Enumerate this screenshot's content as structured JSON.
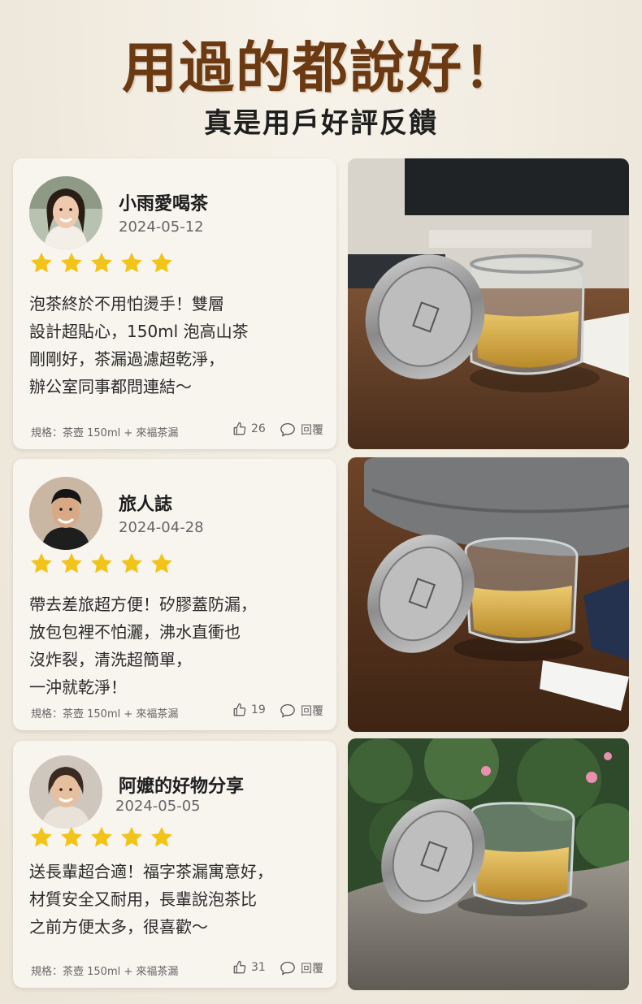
{
  "header": {
    "title": "用過的都說好！",
    "subtitle": "真是用戶好評反饋"
  },
  "colors": {
    "title": "#6b3a12",
    "star": "#f2c318",
    "card_bg": "#f8f5ef",
    "page_bg": "#f1ece2"
  },
  "reviews": [
    {
      "name": "小雨愛喝茶",
      "date": "2024-05-12",
      "rating": 5,
      "lines": [
        "泡茶終於不用怕燙手！雙層",
        "設計超貼心，150ml 泡高山茶",
        "剛剛好，茶漏過濾超乾淨，",
        "辦公室同事都問連結～"
      ],
      "spec": "規格：茶壺 150ml + 來福茶漏",
      "likes": "26",
      "reply": "回覆",
      "photo": "office-desk-tea-cup-photo"
    },
    {
      "name": "旅人誌",
      "date": "2024-04-28",
      "rating": 5,
      "lines": [
        "帶去差旅超方便！矽膠蓋防漏，",
        "放包包裡不怕灑，沸水直衝也",
        "沒炸裂，清洗超簡單，",
        "一沖就乾淨！"
      ],
      "spec": "規格：茶壺 150ml + 來福茶漏",
      "likes": "19",
      "reply": "回覆",
      "photo": "travel-bag-tea-cup-photo"
    },
    {
      "name": "阿嬤的好物分享",
      "date": "2024-05-05",
      "rating": 5,
      "lines": [
        "送長輩超合適！福字茶漏寓意好，",
        "材質安全又耐用，長輩說泡茶比",
        "之前方便太多，很喜歡～"
      ],
      "spec": "規格：茶壺 150ml + 來福茶漏",
      "likes": "31",
      "reply": "回覆",
      "photo": "garden-stone-tea-cup-photo"
    }
  ],
  "icons": {
    "star": "star-icon",
    "like": "thumbs-up-icon",
    "reply": "comment-bubble-icon"
  }
}
